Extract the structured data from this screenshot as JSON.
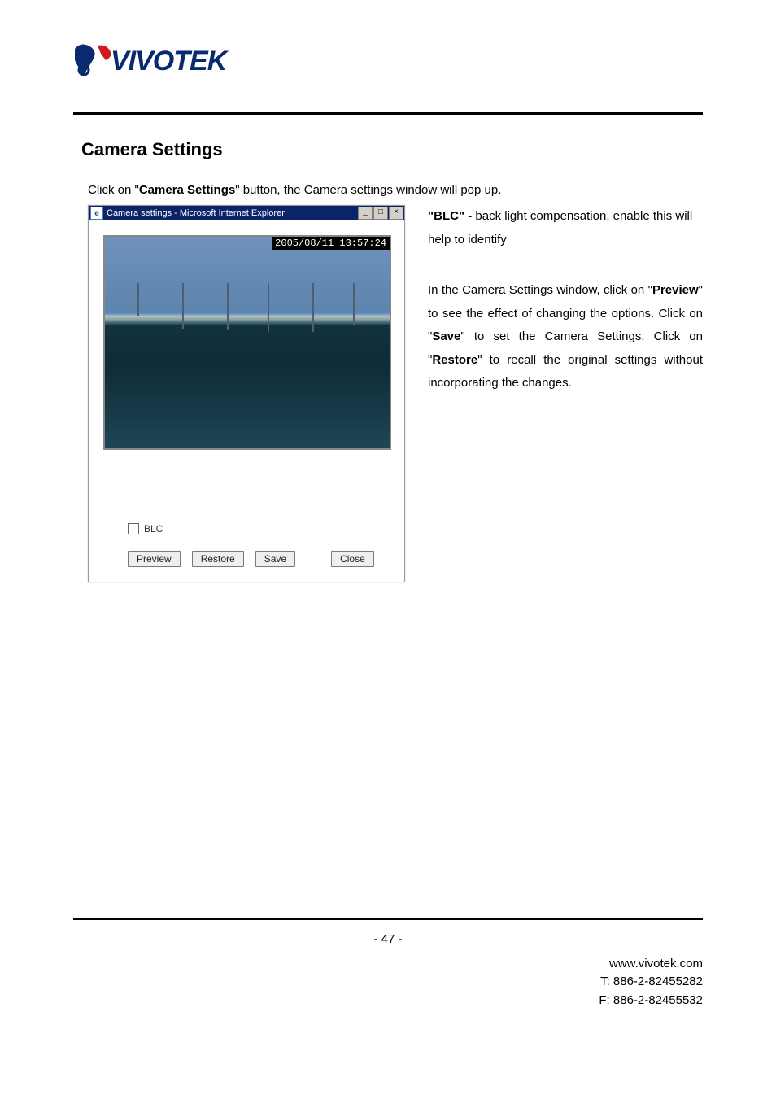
{
  "brand": {
    "name": "VIVOTEK"
  },
  "heading": "Camera Settings",
  "intro": {
    "prefix": "Click on \"",
    "strong": "Camera Settings",
    "suffix": "\" button, the Camera settings window will pop up."
  },
  "popup": {
    "title": "Camera settings - Microsoft Internet Explorer",
    "timestamp": "2005/08/11 13:57:24",
    "blc_label": "BLC",
    "buttons": {
      "preview": "Preview",
      "restore": "Restore",
      "save": "Save",
      "close": "Close"
    },
    "win": {
      "min": "_",
      "max": "□",
      "close": "×"
    }
  },
  "right": {
    "para1_strong": "\"BLC\" - ",
    "para1_rest": "back light compensation, enable this will help to identify",
    "para2_pre": "In the Camera Settings window, click on \"",
    "para2_b1": "Preview",
    "para2_m1": "\" to see the effect of changing the options. Click on \"",
    "para2_b2": "Save",
    "para2_m2": "\" to set the Camera Settings. Click on \"",
    "para2_b3": "Restore",
    "para2_end": "\" to recall the original settings without incorporating the changes."
  },
  "footer": {
    "page": "- 47 -",
    "url": "www.vivotek.com",
    "tel": "T: 886-2-82455282",
    "fax": "F: 886-2-82455532"
  }
}
